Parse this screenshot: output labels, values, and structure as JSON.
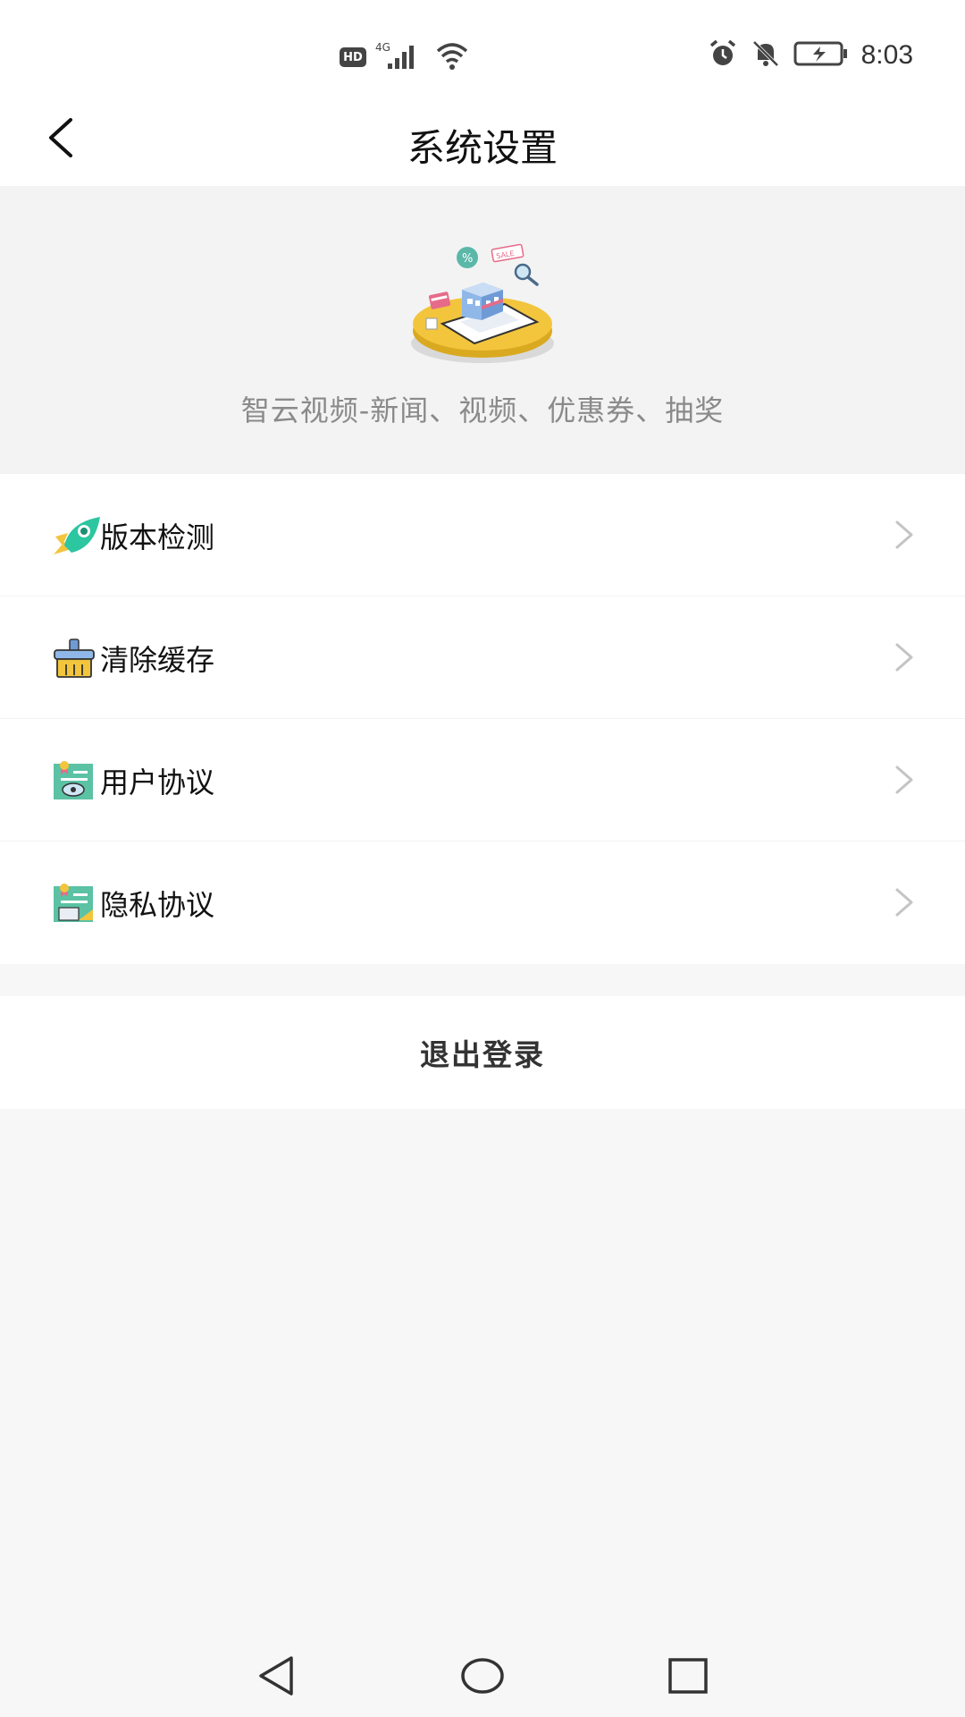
{
  "status_bar": {
    "network_badge": "HD",
    "network_type": "4G",
    "time": "8:03",
    "icons": [
      "signal-icon",
      "wifi-icon",
      "alarm-icon",
      "mute-icon",
      "battery-icon"
    ]
  },
  "header": {
    "title": "系统设置",
    "back_icon": "back-arrow-icon"
  },
  "hero": {
    "tagline": "智云视频-新闻、视频、优惠券、抽奖",
    "illustration_icon": "shop-illustration-icon"
  },
  "menu": {
    "items": [
      {
        "label": "版本检测",
        "icon": "rocket-icon"
      },
      {
        "label": "清除缓存",
        "icon": "broom-icon"
      },
      {
        "label": "用户协议",
        "icon": "user-agreement-icon"
      },
      {
        "label": "隐私协议",
        "icon": "privacy-agreement-icon"
      }
    ]
  },
  "logout": {
    "label": "退出登录"
  },
  "colors": {
    "background": "#f7f7f7",
    "panel": "#ffffff",
    "accent_teal": "#2cc6a0",
    "accent_yellow": "#f2c53d",
    "muted_text": "#8a8a8a"
  }
}
